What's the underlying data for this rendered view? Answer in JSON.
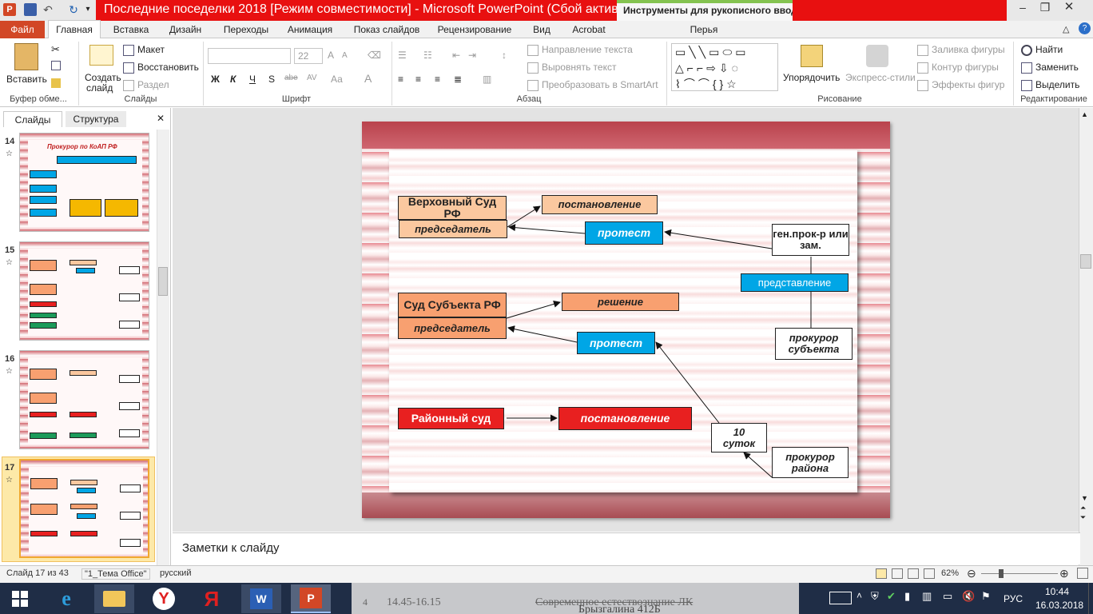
{
  "title_bar": {
    "title": "Последние поседелки 2018 [Режим совместимости]  -  Microsoft PowerPoint (Сбой актива...",
    "contextual_tools": "Инструменты для рукописного ввода",
    "contextual_tab": "Перья"
  },
  "tabs": [
    "Файл",
    "Главная",
    "Вставка",
    "Дизайн",
    "Переходы",
    "Анимация",
    "Показ слайдов",
    "Рецензирование",
    "Вид",
    "Acrobat",
    "Перья"
  ],
  "ribbon": {
    "clipboard": {
      "paste": "Вставить",
      "group": "Буфер обме..."
    },
    "slides": {
      "new_slide_1": "Создать",
      "new_slide_2": "слайд",
      "layout": "Макет",
      "reset": "Восстановить",
      "section": "Раздел",
      "group": "Слайды"
    },
    "font": {
      "size": "22",
      "group": "Шрифт",
      "bold": "Ж",
      "italic": "К",
      "underline": "Ч",
      "strike": "S",
      "spacing": "abe",
      "case": "Аа",
      "shift": "AV"
    },
    "paragraph": {
      "text_direction": "Направление текста",
      "align_text": "Выровнять текст",
      "smartart": "Преобразовать в SmartArt",
      "group": "Абзац"
    },
    "drawing": {
      "arrange": "Упорядочить",
      "quick_styles": "Экспресс-стили",
      "fill": "Заливка фигуры",
      "outline": "Контур фигуры",
      "effects": "Эффекты фигур",
      "group": "Рисование"
    },
    "editing": {
      "find": "Найти",
      "replace": "Заменить",
      "select": "Выделить",
      "group": "Редактирование"
    }
  },
  "left_pane": {
    "tab_slides": "Слайды",
    "tab_outline": "Структура",
    "slides": [
      {
        "num": "14",
        "title": "Прокурор  по КоАП РФ"
      },
      {
        "num": "15"
      },
      {
        "num": "16"
      },
      {
        "num": "17"
      }
    ]
  },
  "slide": {
    "supreme_court": "Верховный Суд РФ",
    "chairman_1": "председатель",
    "resolution_1": "постановление",
    "protest_1": "протест",
    "gen_prosecutor": "ген.прок-р или зам.",
    "representation": "представление",
    "regional_court": "Суд Субъекта РФ",
    "chairman_2": "председатель",
    "decision": "решение",
    "protest_2": "протест",
    "regional_prosecutor": "прокурор субъекта",
    "district_court": "Районный суд",
    "resolution_2": "постановление",
    "ten_days": "10 суток",
    "district_prosecutor": "прокурор района"
  },
  "notes_placeholder": "Заметки к слайду",
  "status": {
    "slide_of": "Слайд 17 из 43",
    "theme": "\"1_Тема Office\"",
    "language": "русский",
    "zoom": "62%"
  },
  "taskbar": {
    "lang": "РУС",
    "time": "10:44",
    "date": "16.03.2018",
    "bg_text_1": "14.45-16.15",
    "bg_text_2": "Современное естествознание ЛК",
    "bg_text_3": "Брызгалина 412Б",
    "bg_num": "4"
  },
  "colors": {
    "accent_red": "#e81010",
    "file_tab": "#d24726",
    "contextual_green": "#84c350",
    "slide_blue": "#00a6e6",
    "slide_red": "#e82020"
  }
}
